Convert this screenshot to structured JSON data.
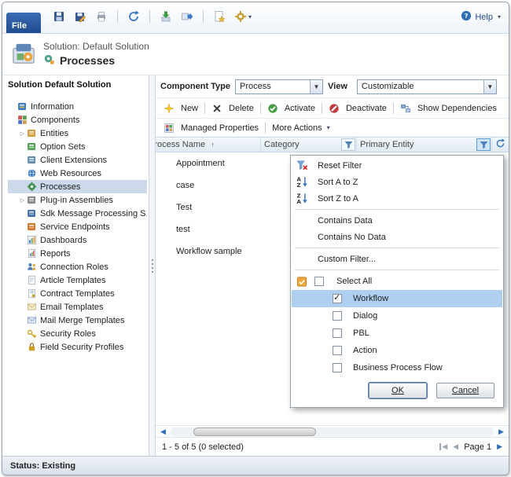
{
  "colors": {
    "accent_blue": "#2e6db4",
    "menu_highlight": "#aecff0",
    "filter_badge_orange": "#f0a93c",
    "selected_tree_item": "#ccd9ea",
    "file_tab_blue": "#1f4c8f"
  },
  "window": {
    "file_tab": "File",
    "help_label": "Help",
    "toolbar_icons": [
      "save-icon",
      "save-as-icon",
      "print-icon",
      "sep",
      "refresh-icon",
      "sep",
      "import-icon",
      "export-icon",
      "sep",
      "new-record-icon",
      "settings-icon"
    ],
    "status_text": "Status: Existing"
  },
  "header": {
    "solution_label": "Solution: Default Solution",
    "page_title": "Processes"
  },
  "sidebar": {
    "title": "Solution Default Solution",
    "items": [
      {
        "label": "Information",
        "icon": "information-icon",
        "level": 1,
        "expandable": false,
        "selected": false
      },
      {
        "label": "Components",
        "icon": "components-icon",
        "level": 1,
        "expandable": false,
        "selected": false
      },
      {
        "label": "Entities",
        "icon": "entities-icon",
        "level": 2,
        "expandable": true,
        "selected": false
      },
      {
        "label": "Option Sets",
        "icon": "option-sets-icon",
        "level": 2,
        "expandable": false,
        "selected": false
      },
      {
        "label": "Client Extensions",
        "icon": "client-extensions-icon",
        "level": 2,
        "expandable": false,
        "selected": false
      },
      {
        "label": "Web Resources",
        "icon": "web-resources-icon",
        "level": 2,
        "expandable": false,
        "selected": false
      },
      {
        "label": "Processes",
        "icon": "processes-icon",
        "level": 2,
        "expandable": false,
        "selected": true
      },
      {
        "label": "Plug-in Assemblies",
        "icon": "plugin-assemblies-icon",
        "level": 2,
        "expandable": true,
        "selected": false
      },
      {
        "label": "Sdk Message Processing S...",
        "icon": "sdk-message-icon",
        "level": 2,
        "expandable": false,
        "selected": false
      },
      {
        "label": "Service Endpoints",
        "icon": "service-endpoints-icon",
        "level": 2,
        "expandable": false,
        "selected": false
      },
      {
        "label": "Dashboards",
        "icon": "dashboards-icon",
        "level": 2,
        "expandable": false,
        "selected": false
      },
      {
        "label": "Reports",
        "icon": "reports-icon",
        "level": 2,
        "expandable": false,
        "selected": false
      },
      {
        "label": "Connection Roles",
        "icon": "connection-roles-icon",
        "level": 2,
        "expandable": false,
        "selected": false
      },
      {
        "label": "Article Templates",
        "icon": "article-templates-icon",
        "level": 2,
        "expandable": false,
        "selected": false
      },
      {
        "label": "Contract Templates",
        "icon": "contract-templates-icon",
        "level": 2,
        "expandable": false,
        "selected": false
      },
      {
        "label": "Email Templates",
        "icon": "email-templates-icon",
        "level": 2,
        "expandable": false,
        "selected": false
      },
      {
        "label": "Mail Merge Templates",
        "icon": "mail-merge-icon",
        "level": 2,
        "expandable": false,
        "selected": false
      },
      {
        "label": "Security Roles",
        "icon": "security-roles-icon",
        "level": 2,
        "expandable": false,
        "selected": false
      },
      {
        "label": "Field Security Profiles",
        "icon": "field-security-icon",
        "level": 2,
        "expandable": false,
        "selected": false
      }
    ]
  },
  "main": {
    "component_type": {
      "label": "Component Type",
      "value": "Process"
    },
    "view": {
      "label": "View",
      "value": "Customizable"
    },
    "actions": [
      {
        "label": "New",
        "icon": "new-icon"
      },
      {
        "label": "Delete",
        "icon": "delete-icon"
      },
      {
        "label": "Activate",
        "icon": "activate-icon"
      },
      {
        "label": "Deactivate",
        "icon": "deactivate-icon"
      },
      {
        "label": "Show Dependencies",
        "icon": "dependencies-icon"
      }
    ],
    "actions2": [
      {
        "label": "Managed Properties",
        "icon": "managed-properties-icon"
      },
      {
        "label": "More Actions",
        "caret": true
      }
    ],
    "grid": {
      "columns": [
        {
          "label": "Process Name",
          "sort": "ascending"
        },
        {
          "label": "Category",
          "filter": true
        },
        {
          "label": "Primary Entity",
          "filter": true,
          "filter_active": true
        }
      ],
      "rows": [
        {
          "process_name": "Appointment"
        },
        {
          "process_name": "case"
        },
        {
          "process_name": "Test"
        },
        {
          "process_name": "test"
        },
        {
          "process_name": "Workflow sample"
        }
      ]
    },
    "pager": {
      "summary": "1 - 5 of 5 (0 selected)",
      "page_label": "Page 1",
      "icons": [
        "first-page-icon",
        "previous-page-icon",
        "next-page-icon"
      ]
    }
  },
  "filter_menu": {
    "commands": [
      {
        "label": "Reset Filter",
        "icon": "reset-filter-icon"
      },
      {
        "label": "Sort A to Z",
        "icon": "sort-az-icon"
      },
      {
        "label": "Sort Z to A",
        "icon": "sort-za-icon"
      },
      {
        "separator": true
      },
      {
        "label": "Contains Data"
      },
      {
        "label": "Contains No Data"
      },
      {
        "separator": true
      },
      {
        "label": "Custom Filter..."
      },
      {
        "separator": true
      }
    ],
    "select_all": {
      "label": "Select All",
      "checked": false
    },
    "options": [
      {
        "label": "Workflow",
        "checked": true,
        "highlighted": true
      },
      {
        "label": "Dialog",
        "checked": false
      },
      {
        "label": "PBL",
        "checked": false
      },
      {
        "label": "Action",
        "checked": false
      },
      {
        "label": "Business Process Flow",
        "checked": false
      }
    ],
    "ok_label": "OK",
    "cancel_label": "Cancel"
  }
}
